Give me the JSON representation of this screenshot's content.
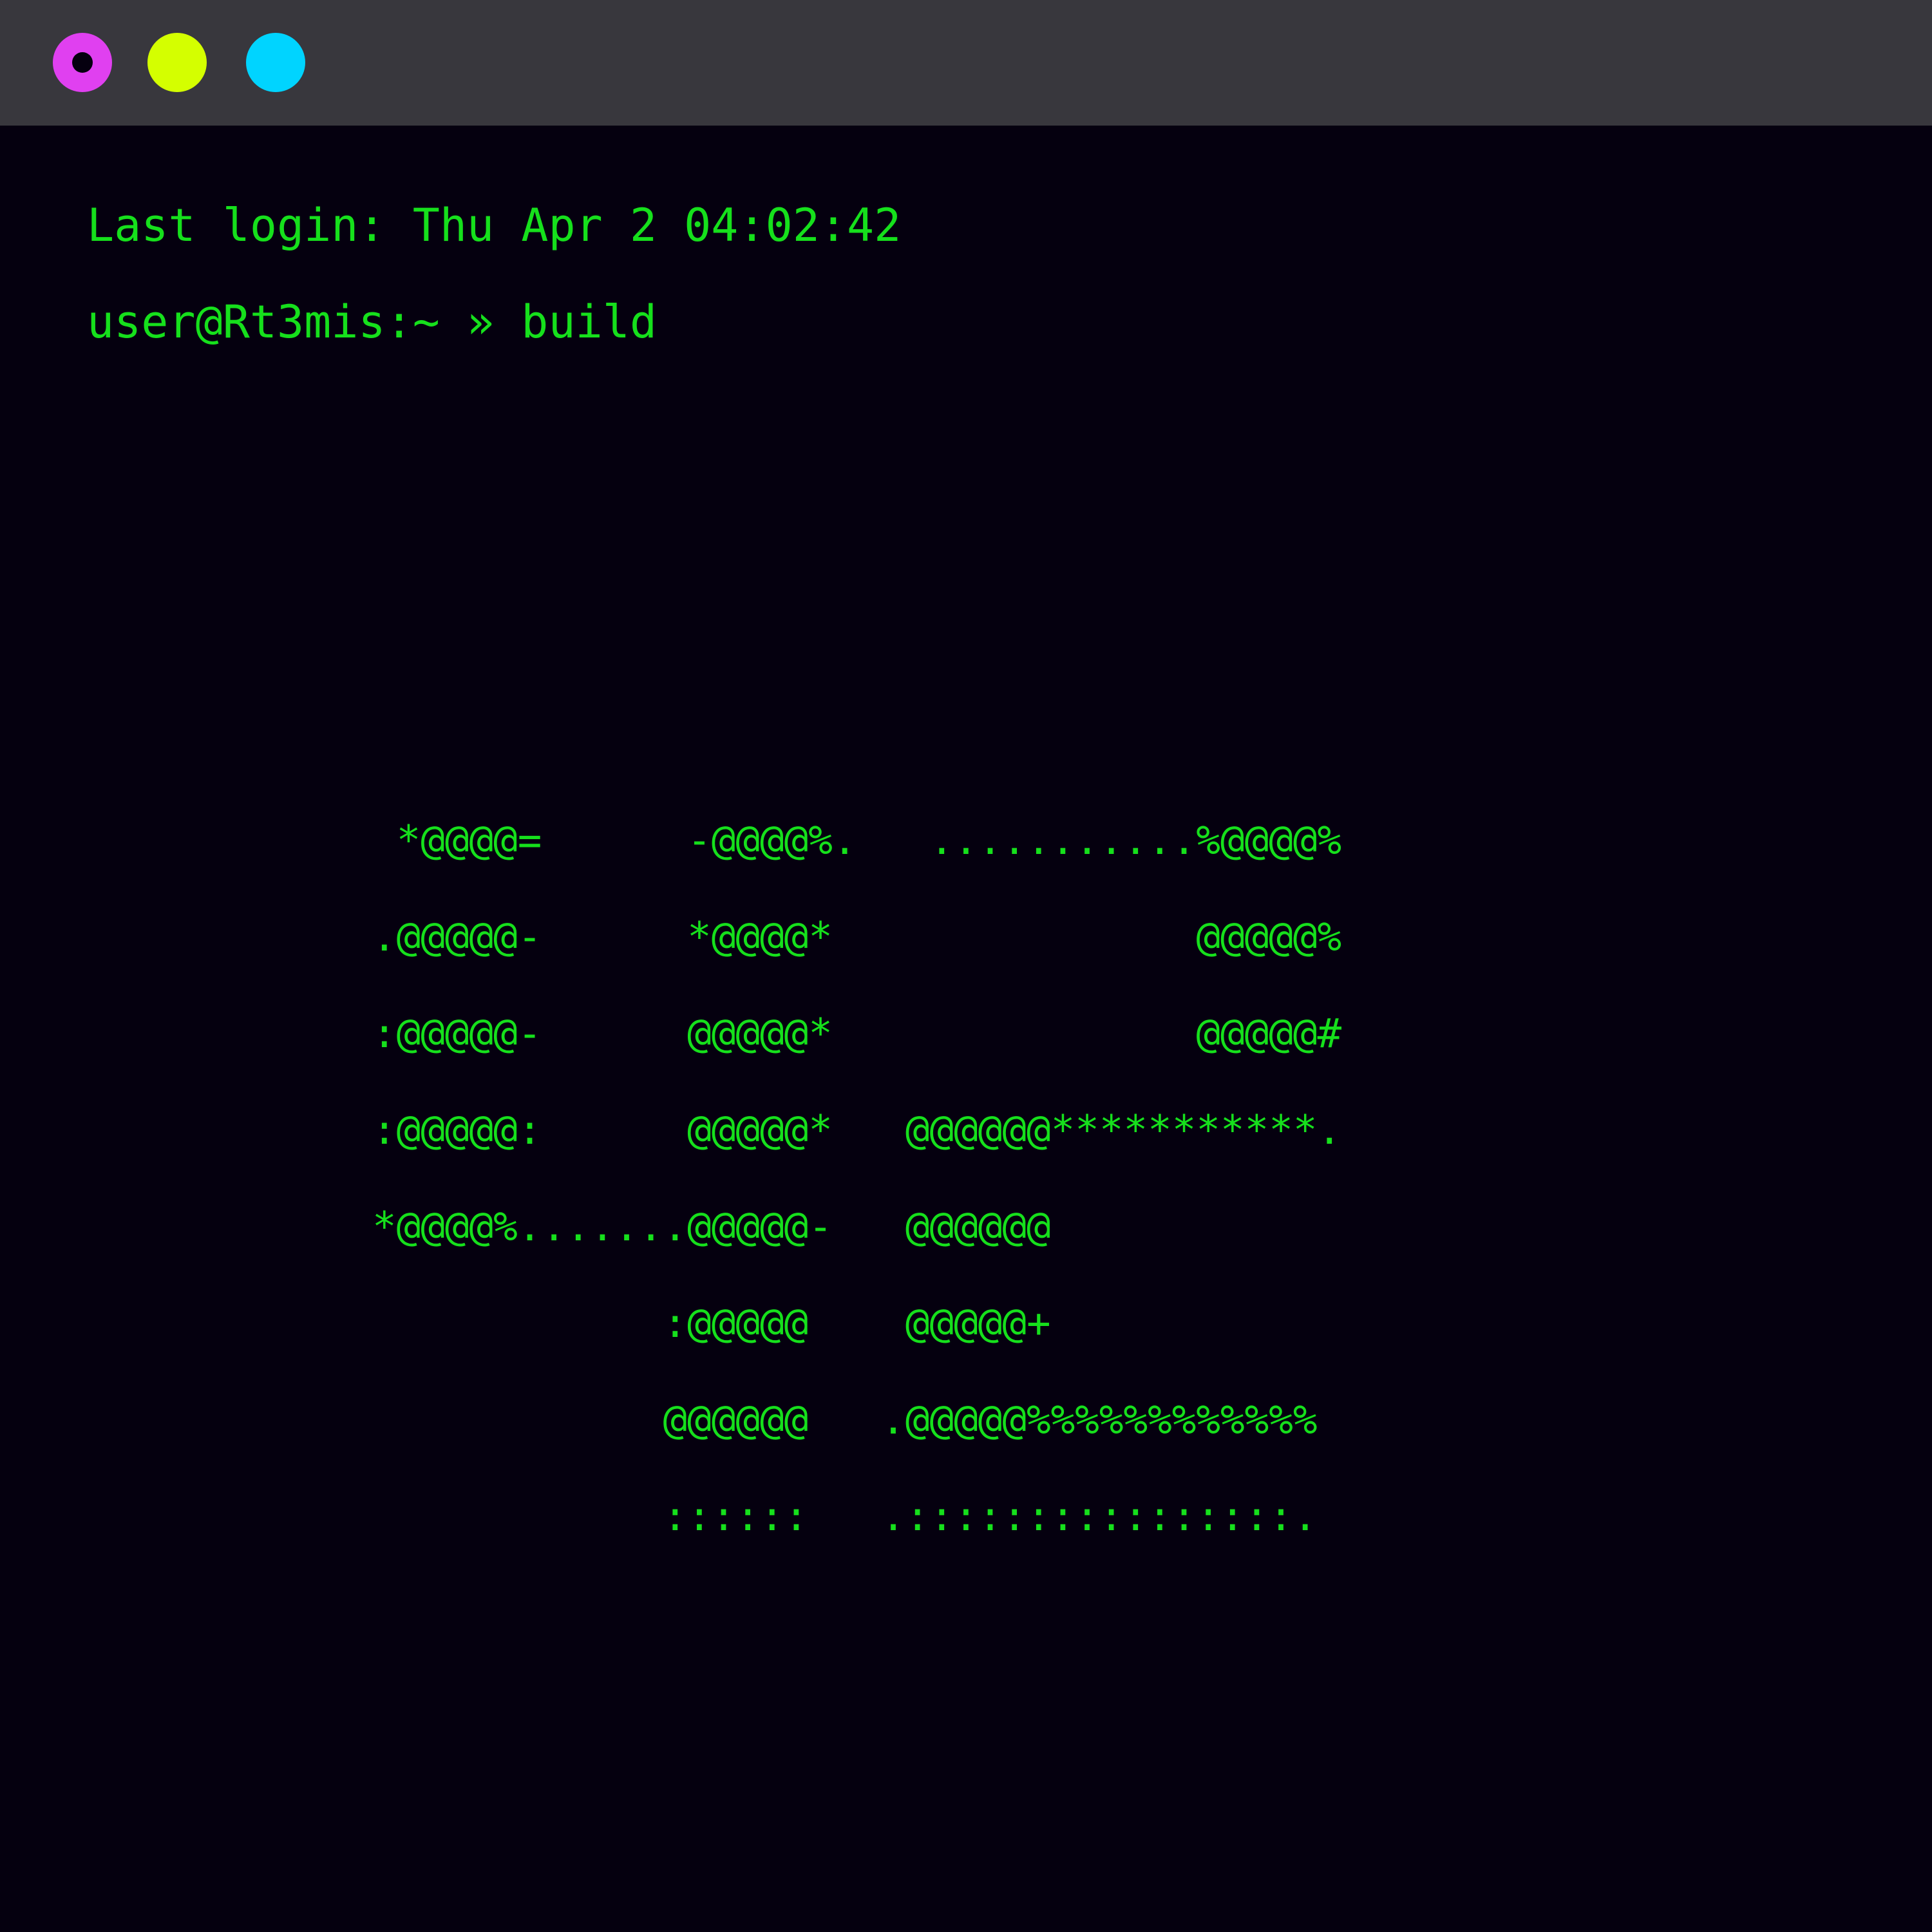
{
  "window": {
    "controls": [
      {
        "name": "close",
        "color": "#e040f0"
      },
      {
        "name": "minimize",
        "color": "#d4ff00"
      },
      {
        "name": "maximize",
        "color": "#00d4ff"
      }
    ]
  },
  "terminal": {
    "text_color": "#16e01c",
    "background": "#05000f",
    "login_line": "Last login: Thu Apr 2 04:02:42",
    "prompt": "user@Rt3mis:~ » build",
    "ascii_art": [
      " *@@@@=      -@@@@%.   ...........%@@@@%",
      ".@@@@@-      *@@@@*               @@@@@%",
      ":@@@@@-      @@@@@*               @@@@@#",
      ":@@@@@:      @@@@@*   @@@@@@***********.",
      "*@@@@%.......@@@@@-   @@@@@@",
      "            :@@@@@    @@@@@+",
      "            @@@@@@   .@@@@@%%%%%%%%%%%%",
      "            ::::::   .::::::::::::::::."
    ]
  }
}
